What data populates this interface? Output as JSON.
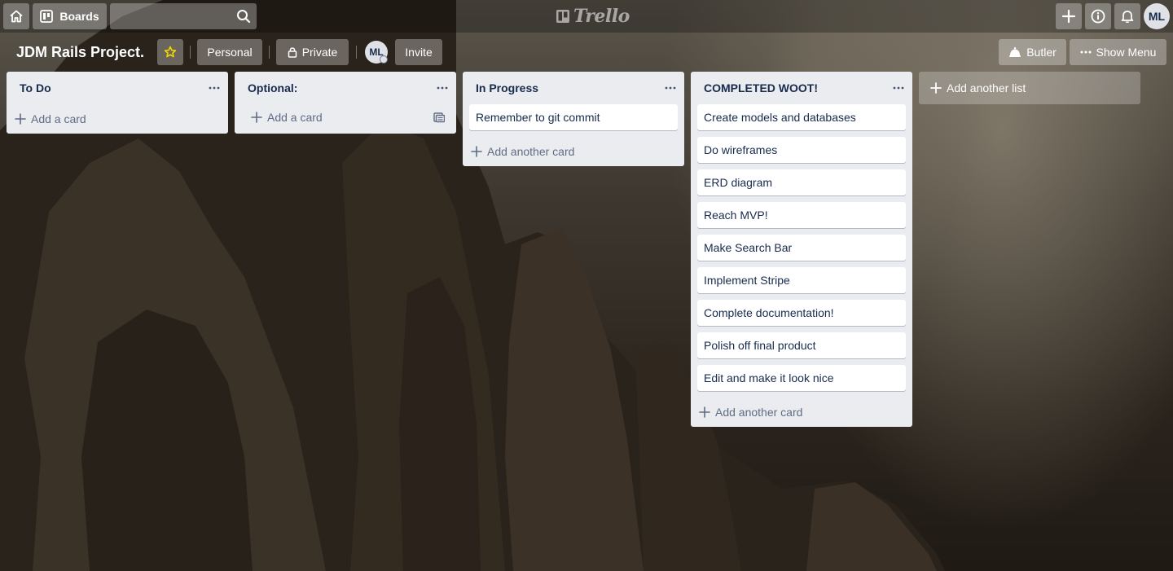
{
  "header": {
    "boards_label": "Boards",
    "logo_text": "Trello",
    "user_initials": "ML"
  },
  "board": {
    "title": "JDM Rails Project.",
    "team_label": "Personal",
    "visibility_label": "Private",
    "member_initials": "ML",
    "invite_label": "Invite",
    "butler_label": "Butler",
    "show_menu_label": "Show Menu"
  },
  "lists": [
    {
      "title": "To Do",
      "cards": [],
      "add_label": "Add a card"
    },
    {
      "title": "Optional:",
      "cards": [],
      "add_label": "Add a card"
    },
    {
      "title": "In Progress",
      "cards": [
        "Remember to git commit"
      ],
      "add_label": "Add another card"
    },
    {
      "title": "COMPLETED WOOT!",
      "cards": [
        "Create models and databases",
        "Do wireframes",
        "ERD diagram",
        "Reach MVP!",
        "Make Search Bar",
        "Implement Stripe",
        "Complete documentation!",
        "Polish off final product",
        "Edit and make it look nice"
      ],
      "add_label": "Add another card"
    }
  ],
  "add_list_label": "Add another list",
  "colors": {
    "list_bg": "#ebecf0",
    "card_text": "#172b4d",
    "muted_text": "#5e6c84",
    "star": "#f2d600"
  },
  "icons": [
    "home-icon",
    "boards-icon",
    "search-icon",
    "trello-logo-icon",
    "plus-icon",
    "info-icon",
    "bell-icon",
    "star-icon",
    "lock-icon",
    "butler-icon",
    "more-icon",
    "template-icon"
  ]
}
